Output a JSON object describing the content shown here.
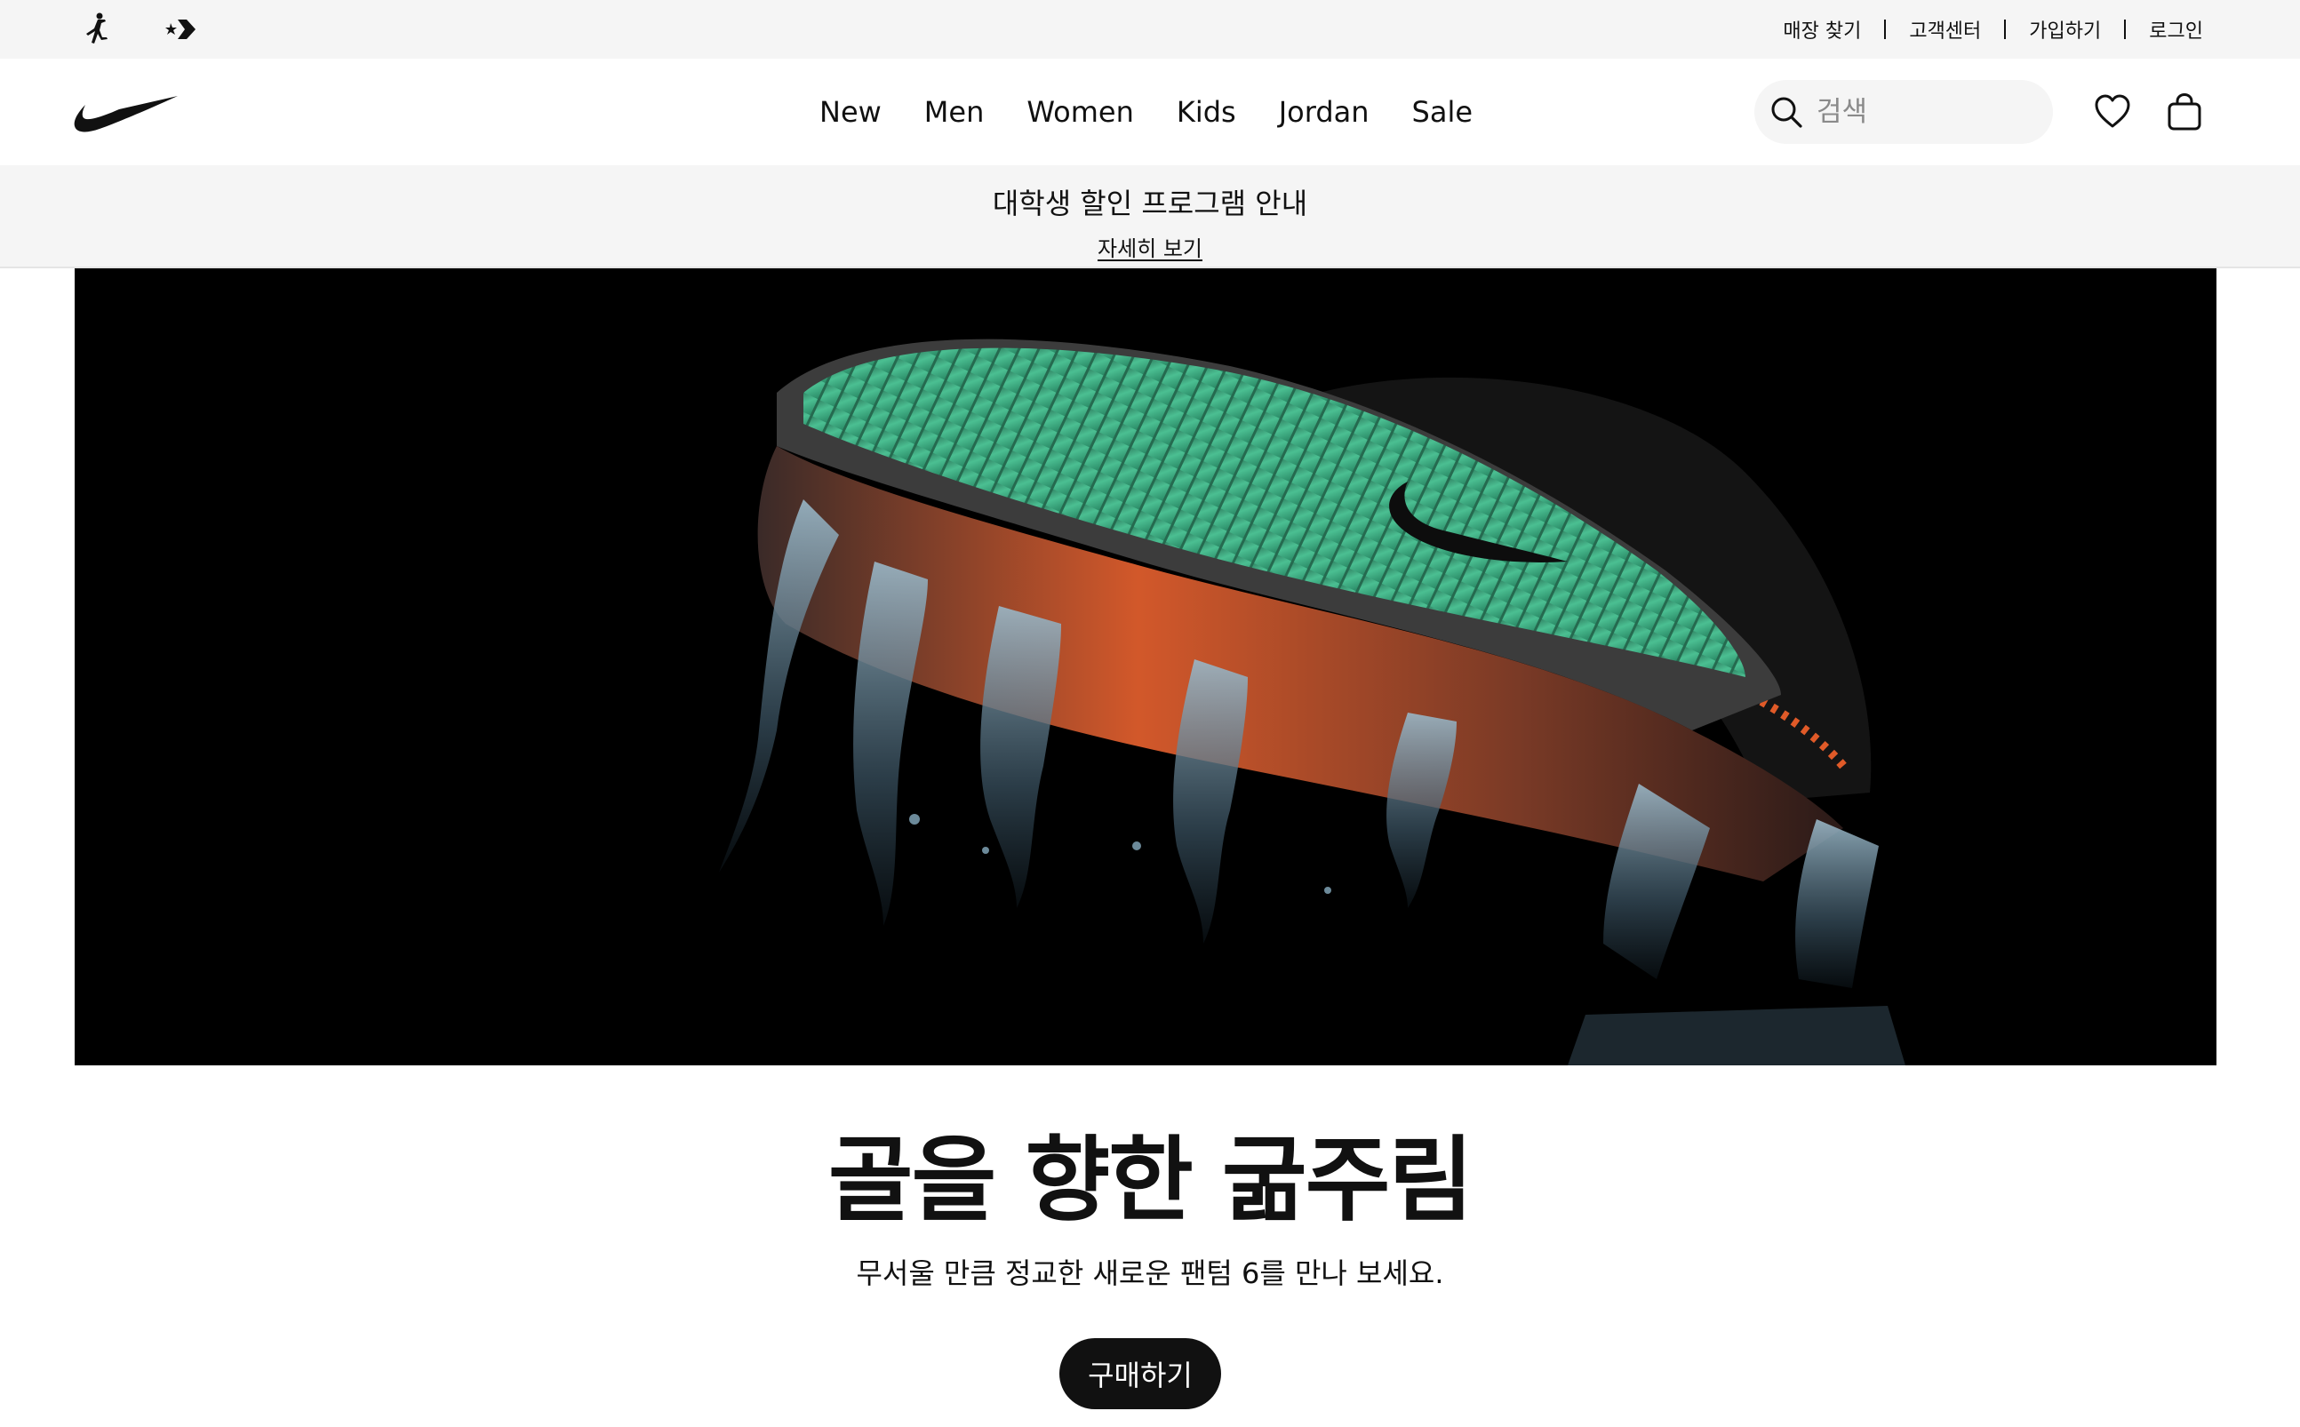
{
  "utility_bar": {
    "brand_icons": [
      "jordan-jumpman-icon",
      "converse-star-chevron-icon"
    ],
    "links": [
      "매장 찾기",
      "고객센터",
      "가입하기",
      "로그인"
    ]
  },
  "nav": {
    "logo": "nike-swoosh-icon",
    "links": [
      "New",
      "Men",
      "Women",
      "Kids",
      "Jordan",
      "Sale"
    ],
    "search": {
      "placeholder": "검색",
      "icon": "search-icon"
    },
    "icons": [
      "heart-icon",
      "shopping-bag-icon"
    ]
  },
  "promo": {
    "text": "대학생 할인 프로그램 안내",
    "link": "자세히 보기"
  },
  "hero": {
    "image": "football-boot-product-photo",
    "title": "골을 향한 굶주림",
    "subtitle": "무서울 만큼 정교한 새로운 팬텀 6를 만나 보세요.",
    "cta": "구매하기"
  },
  "colors": {
    "utility_bg": "#f5f5f5",
    "text": "#111111",
    "hero_bg": "#000000",
    "boot_green": "#3fae84",
    "boot_orange": "#e0602e",
    "cta_bg": "#111111",
    "cta_text": "#ffffff"
  }
}
